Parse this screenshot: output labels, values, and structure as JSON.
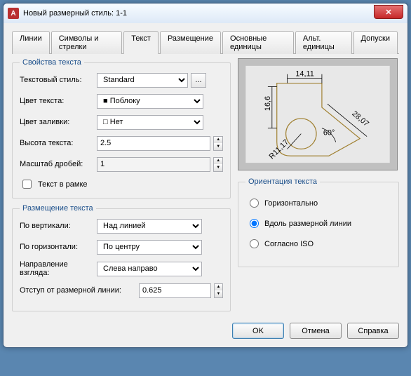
{
  "window": {
    "title": "Новый размерный стиль: 1-1"
  },
  "tabs": [
    "Линии",
    "Символы и стрелки",
    "Текст",
    "Размещение",
    "Основные единицы",
    "Альт. единицы",
    "Допуски"
  ],
  "active_tab": 2,
  "text_props": {
    "legend": "Свойства текста",
    "style_label": "Текстовый стиль:",
    "style_value": "Standard",
    "browse": "...",
    "color_label": "Цвет текста:",
    "color_value": "Поблоку",
    "fill_label": "Цвет заливки:",
    "fill_value": "Нет",
    "height_label": "Высота текста:",
    "height_value": "2.5",
    "frac_label": "Масштаб дробей:",
    "frac_value": "1",
    "frame_label": "Текст в рамке"
  },
  "placement": {
    "legend": "Размещение текста",
    "vert_label": "По вертикали:",
    "vert_value": "Над линией",
    "horiz_label": "По горизонтали:",
    "horiz_value": "По центру",
    "dir_label": "Направление взгляда:",
    "dir_value": "Слева направо",
    "offset_label": "Отступ от размерной линии:",
    "offset_value": "0.625"
  },
  "orientation": {
    "legend": "Ориентация текста",
    "opt1": "Горизонтально",
    "opt2": "Вдоль размерной линии",
    "opt3": "Согласно ISO"
  },
  "preview": {
    "d1": "14,11",
    "d2": "16,6",
    "d3": "28,07",
    "d4": "R11,17",
    "d5": "60°"
  },
  "buttons": {
    "ok": "OK",
    "cancel": "Отмена",
    "help": "Справка"
  }
}
